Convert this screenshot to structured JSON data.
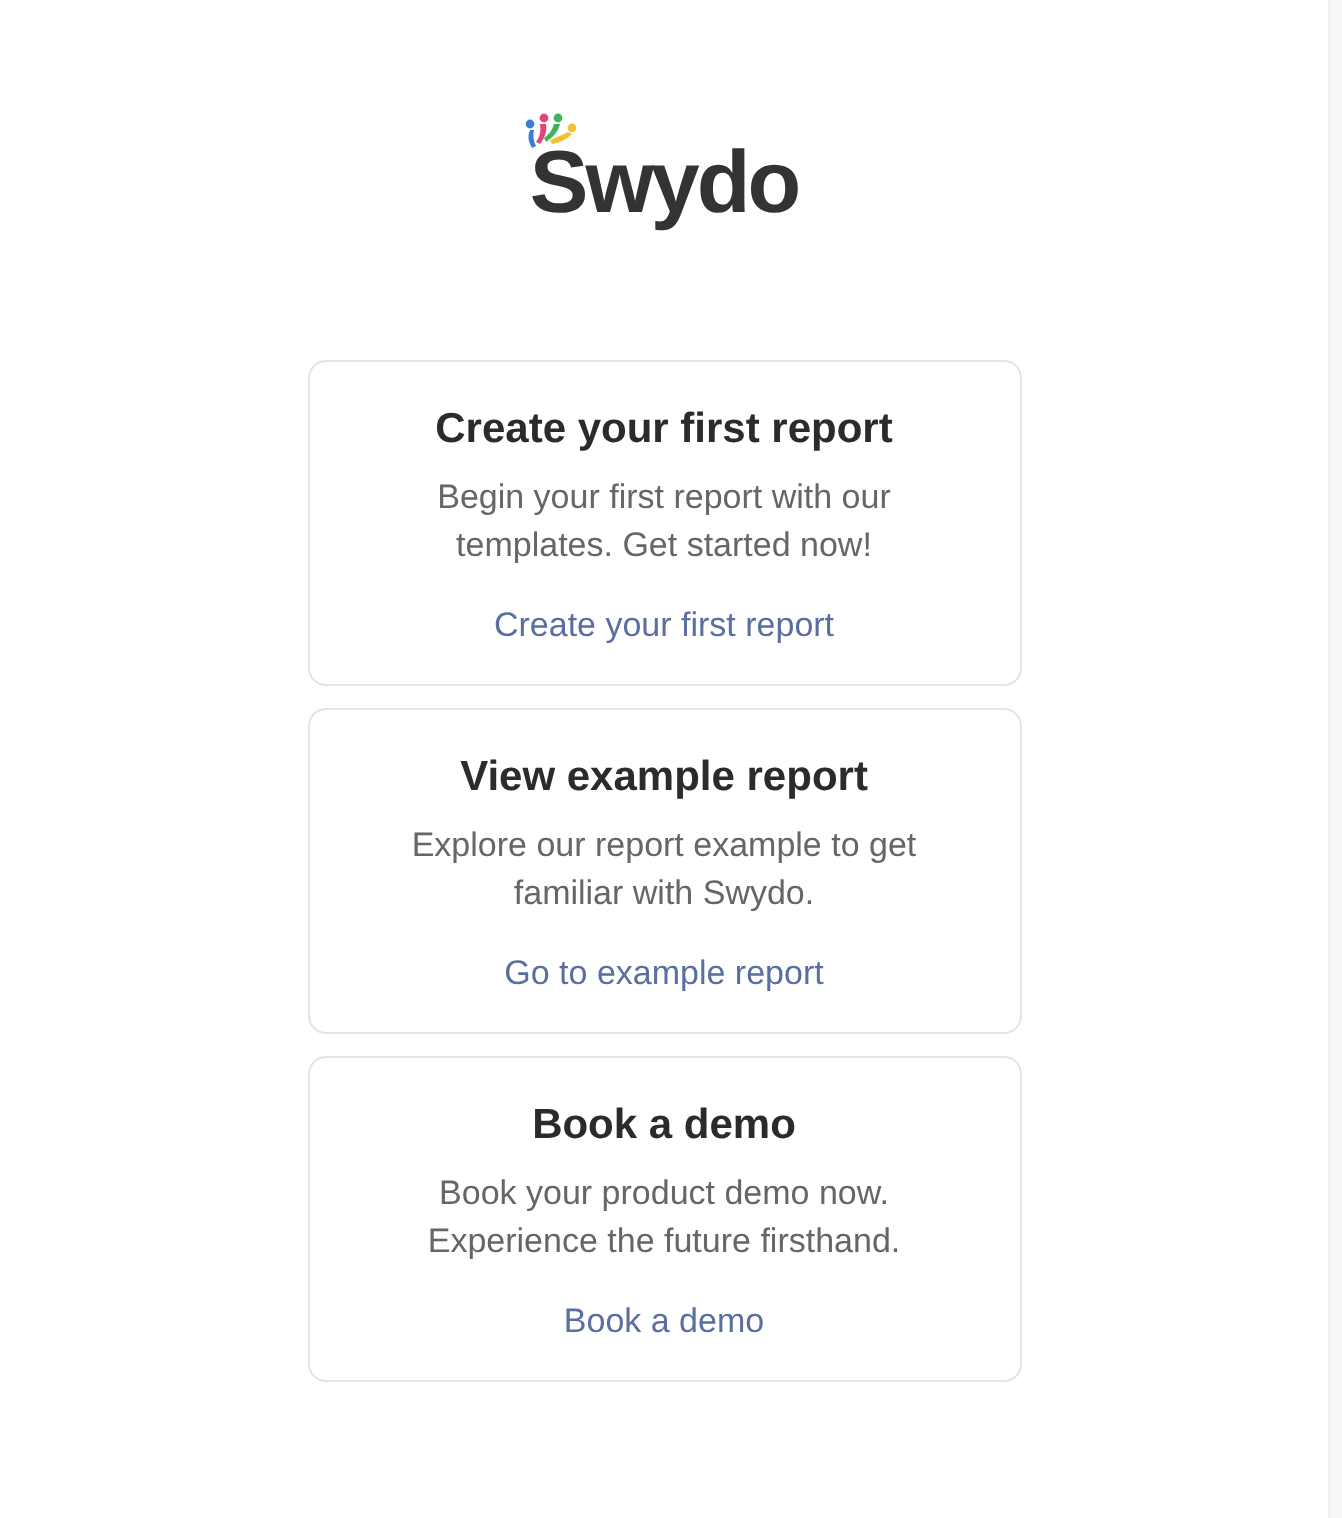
{
  "logo": {
    "text": "Swydo"
  },
  "cards": [
    {
      "title": "Create your first report",
      "description_lines": [
        "Begin your first report with our",
        "templates. Get started now!"
      ],
      "link": "Create your first report"
    },
    {
      "title": "View example report",
      "description_lines": [
        "Explore our report example to get",
        "familiar with Swydo."
      ],
      "link": "Go to example report"
    },
    {
      "title": "Book a demo",
      "description_lines": [
        "Book your product demo now.",
        "Experience the future firsthand."
      ],
      "link": "Book a demo"
    }
  ]
}
